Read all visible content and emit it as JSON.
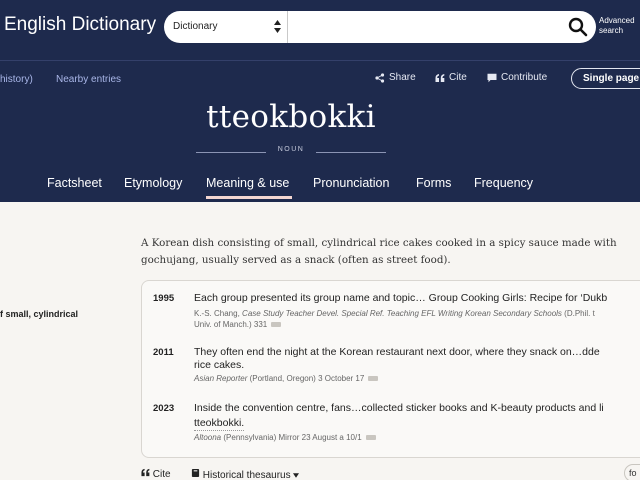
{
  "header": {
    "site_title": "English Dictionary",
    "search": {
      "select_value": "Dictionary",
      "input_value": "",
      "advanced_line1": "Advanced",
      "advanced_line2": "search"
    },
    "subbar": {
      "history_link": "history)",
      "nearby_link": "Nearby entries",
      "share_label": "Share",
      "cite_label": "Cite",
      "contribute_label": "Contribute",
      "single_page_label": "Single page"
    },
    "headword": "tteokbokki",
    "part_of_speech": "NOUN",
    "tabs": [
      {
        "label": "Factsheet"
      },
      {
        "label": "Etymology"
      },
      {
        "label": "Meaning & use",
        "active": true
      },
      {
        "label": "Pronunciation"
      },
      {
        "label": "Forms"
      },
      {
        "label": "Frequency"
      }
    ]
  },
  "main": {
    "left_snippet": "f small, cylindrical",
    "definition": "A Korean dish consisting of small, cylindrical rice cakes cooked in a spicy sauce made with gochujang, usually served as a snack (often as street food).",
    "quotations": [
      {
        "year": "1995",
        "text": "Each group presented its group name and topic… Group Cooking Girls: Recipe for ‘Dukb",
        "cite_author": "K.-S. Chang,",
        "cite_work": "Case Study Teacher Devel. Special Ref. Teaching EFL Writing Korean Secondary Schools",
        "cite_rest": "(D.Phil. t",
        "cite_line2": "Univ. of Manch.) 331"
      },
      {
        "year": "2011",
        "text": "They often end the night at the Korean restaurant next door, where they snack on…dde",
        "text_line2": "rice cakes.",
        "cite_work": "Asian Reporter",
        "cite_rest": "(Portland, Oregon) 3 October 17"
      },
      {
        "year": "2023",
        "text": "Inside the convention centre, fans…collected sticker books and K-beauty products and li",
        "text_line2": "tteokbokki.",
        "cite_work": "Altoona",
        "cite_rest": "(Pennsylvania) Mirror 23 August a 10/1"
      }
    ],
    "bottom": {
      "cite_label": "Cite",
      "thesaurus_label": "Historical thesaurus",
      "right_pill": "fo"
    }
  },
  "colors": {
    "header_bg": "#1e2a4d",
    "tab_active_underline": "#f3d6d1",
    "link": "#a9b6e8",
    "page_bg": "#f7f5f2"
  },
  "icons": [
    "sort-icon",
    "search-icon",
    "share-icon",
    "quote-icon",
    "comment-icon",
    "book-icon",
    "chevron-down-icon"
  ]
}
